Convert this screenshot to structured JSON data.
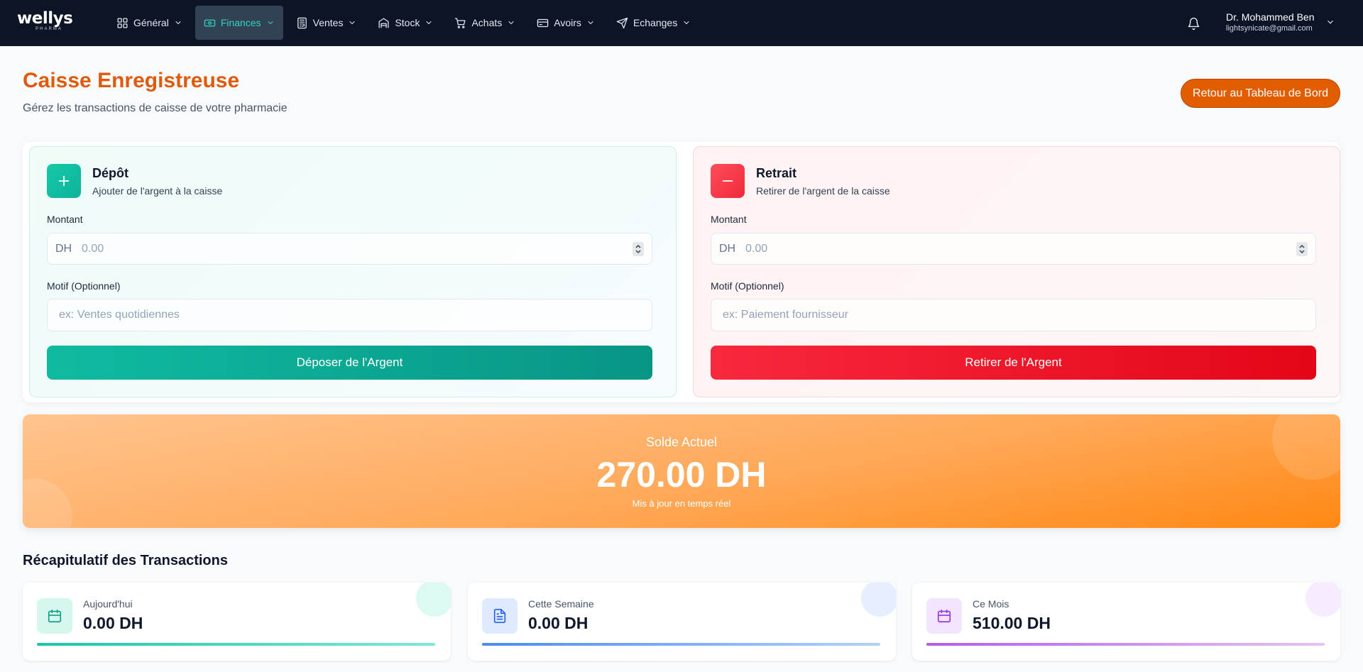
{
  "navbar": {
    "logo_main": "wellys",
    "logo_sub": "PHARMA",
    "items": [
      {
        "label": "Général",
        "icon": "grid-icon"
      },
      {
        "label": "Finances",
        "icon": "money-icon",
        "active": true
      },
      {
        "label": "Ventes",
        "icon": "register-icon"
      },
      {
        "label": "Stock",
        "icon": "warehouse-icon"
      },
      {
        "label": "Achats",
        "icon": "cart-icon"
      },
      {
        "label": "Avoirs",
        "icon": "credit-card-icon"
      },
      {
        "label": "Echanges",
        "icon": "send-icon"
      }
    ],
    "user_name": "Dr. Mohammed Ben",
    "user_email": "lightsynicate@gmail.com"
  },
  "header": {
    "title": "Caisse Enregistreuse",
    "subtitle": "Gérez les transactions de caisse de votre pharmacie",
    "back_button": "Retour au Tableau de Bord"
  },
  "deposit": {
    "title": "Dépôt",
    "description": "Ajouter de l'argent à la caisse",
    "amount_label": "Montant",
    "currency": "DH",
    "amount_placeholder": "0.00",
    "motif_label": "Motif (Optionnel)",
    "motif_placeholder": "ex: Ventes quotidiennes",
    "button": "Déposer de l'Argent"
  },
  "withdraw": {
    "title": "Retrait",
    "description": "Retirer de l'argent de la caisse",
    "amount_label": "Montant",
    "currency": "DH",
    "amount_placeholder": "0.00",
    "motif_label": "Motif (Optionnel)",
    "motif_placeholder": "ex: Paiement fournisseur",
    "button": "Retirer de l'Argent"
  },
  "balance": {
    "label": "Solde Actuel",
    "value": "270.00 DH",
    "note": "Mis à jour en temps réel"
  },
  "summary": {
    "title": "Récapitulatif des Transactions",
    "cards": [
      {
        "label": "Aujourd'hui",
        "value": "0.00 DH",
        "icon": "calendar-icon"
      },
      {
        "label": "Cette Semaine",
        "value": "0.00 DH",
        "icon": "document-icon"
      },
      {
        "label": "Ce Mois",
        "value": "510.00 DH",
        "icon": "calendar-icon"
      }
    ]
  },
  "colors": {
    "brand_orange": "#e05a0c",
    "navbar": "#0b1526",
    "deposit_accent": "#0fb29a",
    "withdraw_accent": "#ef2a3b"
  }
}
